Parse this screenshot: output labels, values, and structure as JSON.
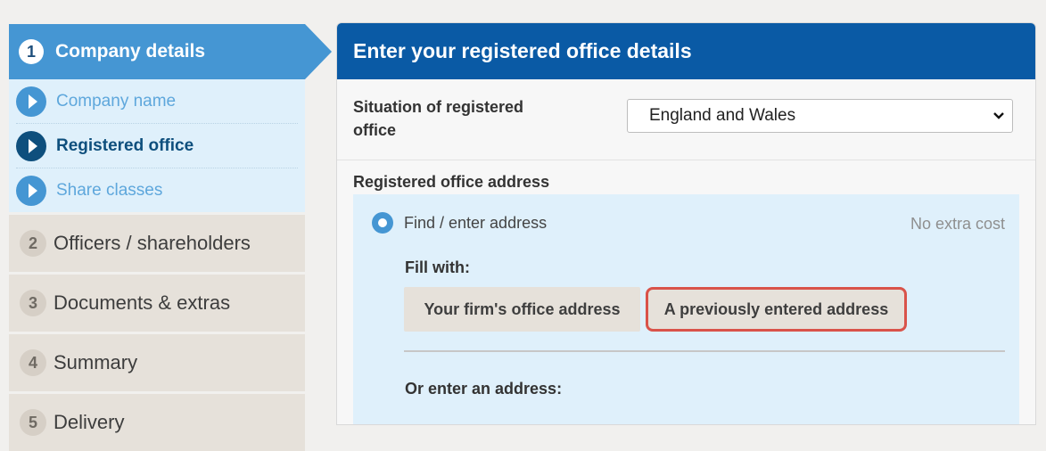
{
  "sidebar": {
    "active_step": {
      "number": "1",
      "label": "Company details"
    },
    "substeps": [
      {
        "label": "Company name",
        "state": "pending"
      },
      {
        "label": "Registered office",
        "state": "current"
      },
      {
        "label": "Share classes",
        "state": "pending"
      }
    ],
    "steps": [
      {
        "number": "2",
        "label": "Officers / shareholders"
      },
      {
        "number": "3",
        "label": "Documents & extras"
      },
      {
        "number": "4",
        "label": "Summary"
      },
      {
        "number": "5",
        "label": "Delivery"
      }
    ]
  },
  "panel": {
    "title": "Enter your registered office details",
    "situation_label": "Situation of registered office",
    "situation_value": "England and Wales",
    "address_label": "Registered office address",
    "find_option_label": "Find / enter address",
    "no_extra_cost": "No extra cost",
    "fill_with": "Fill with:",
    "firm_button": "Your firm's office address",
    "previous_button": "A previously entered address",
    "or_enter": "Or enter an address:"
  },
  "colors": {
    "active_step": "#4596d3",
    "header": "#0a5aa5",
    "highlight_border": "#d9534a",
    "substep_bg": "#dff0fb"
  }
}
